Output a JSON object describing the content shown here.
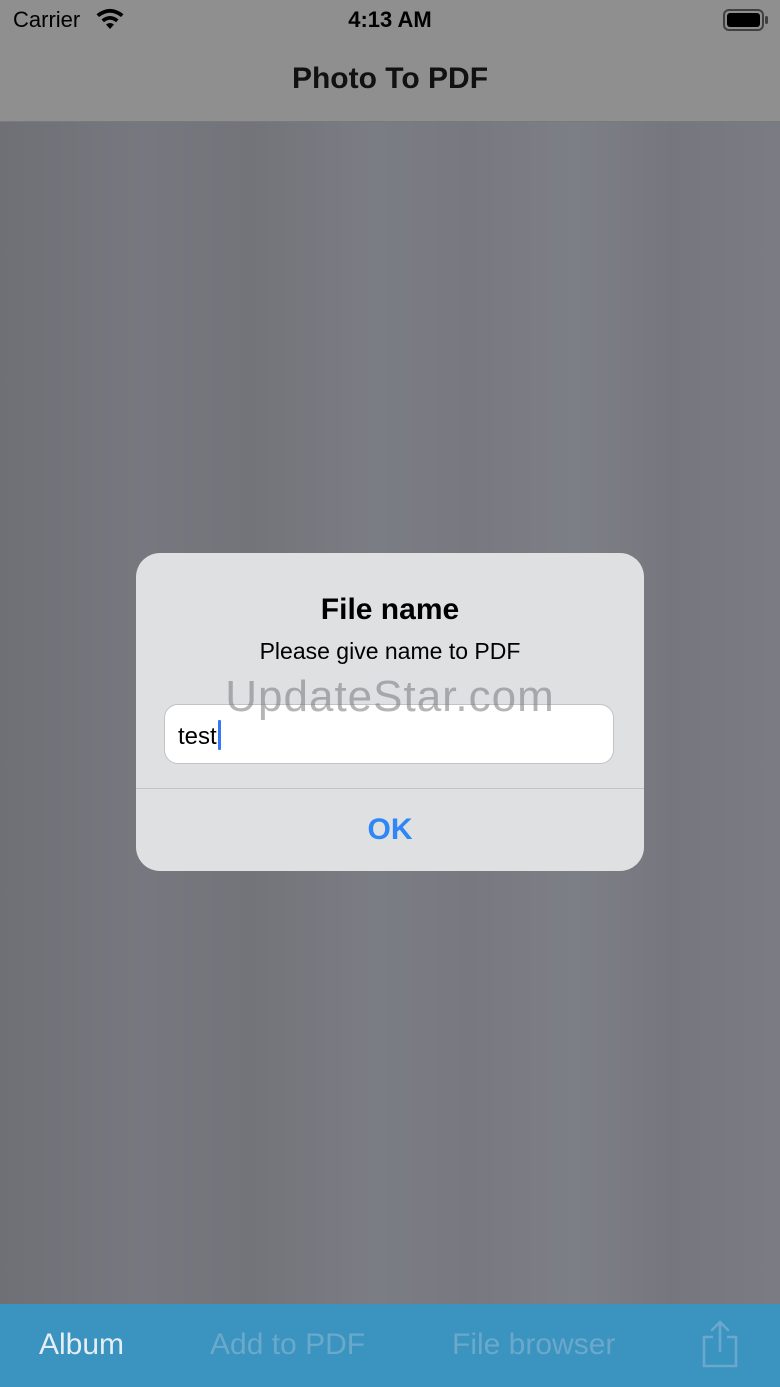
{
  "status_bar": {
    "carrier": "Carrier",
    "time": "4:13 AM",
    "wifi_icon": "wifi-icon",
    "battery_icon": "battery-icon"
  },
  "nav_bar": {
    "title": "Photo To PDF"
  },
  "alert": {
    "title": "File name",
    "message": "Please give name to PDF",
    "input_value": "test",
    "ok_label": "OK"
  },
  "watermark": "UpdateStar.com",
  "toolbar": {
    "album_label": "Album",
    "add_label": "Add to PDF",
    "browser_label": "File browser",
    "share_icon": "share-icon"
  },
  "colors": {
    "toolbar_bg": "#3b93c0",
    "accent": "#2f86f6",
    "caret": "#3478f6"
  }
}
